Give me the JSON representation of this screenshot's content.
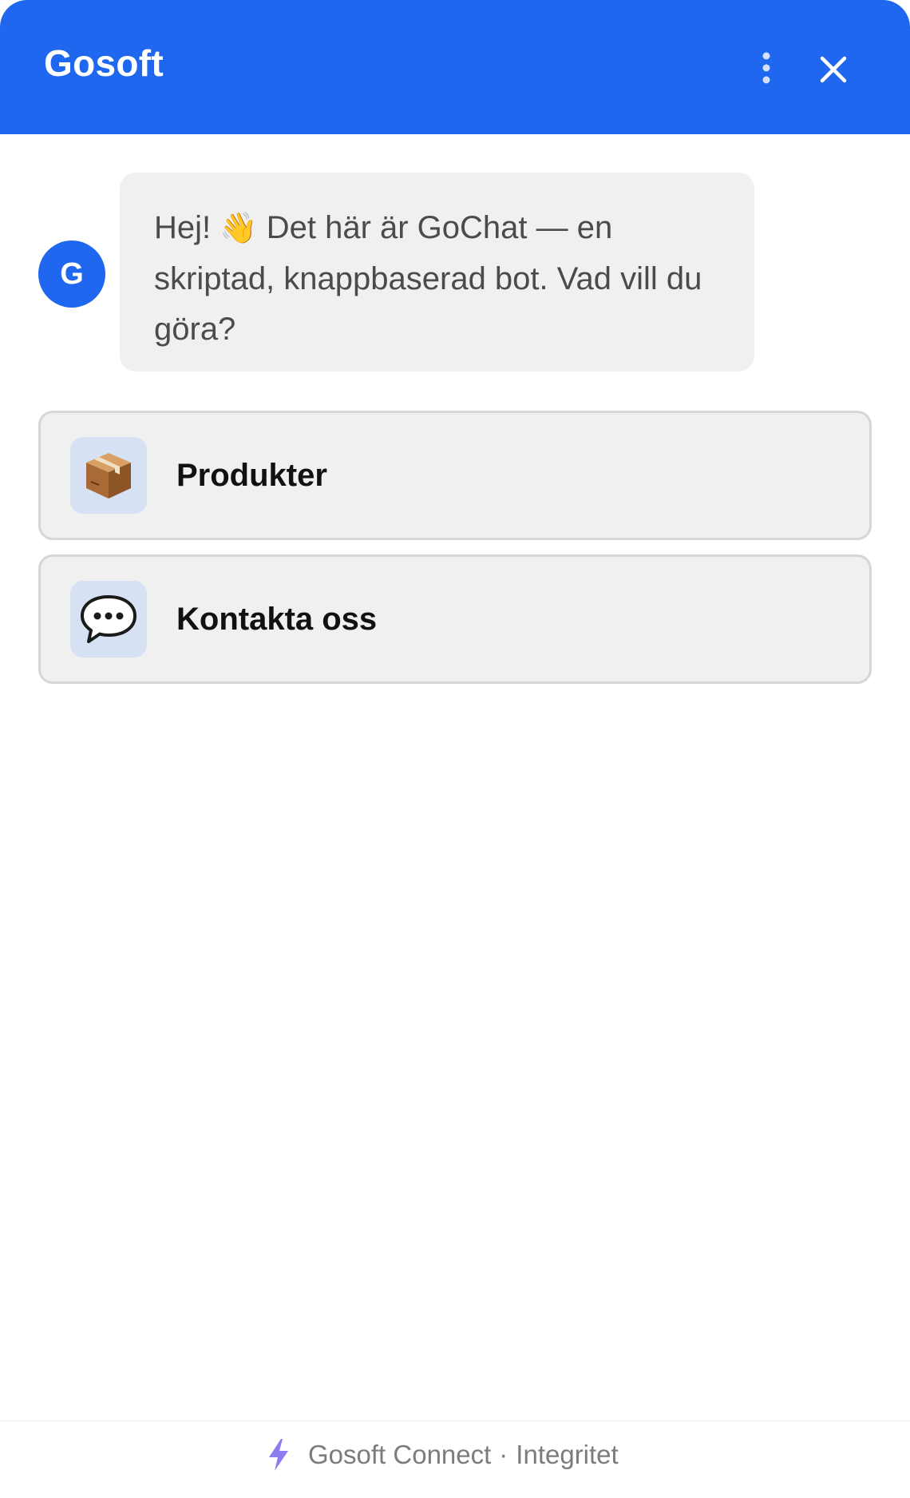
{
  "header": {
    "title": "Gosoft",
    "menu_icon": "more-vertical-icon",
    "close_icon": "close-icon"
  },
  "colors": {
    "brand": "#1e67ee",
    "bubble_bg": "#f0f0f0",
    "option_icon_bg": "#d6e2f4",
    "bolt": "#8b7cf0"
  },
  "message": {
    "avatar_letter": "G",
    "text_before_emoji": "Hej!",
    "emoji": "👋",
    "text_after_emoji": "Det här är GoChat — en skriptad, knappbaserad bot. Vad vill du göra?"
  },
  "options": [
    {
      "label": "Produkter",
      "icon": "package-icon"
    },
    {
      "label": "Kontakta oss",
      "icon": "speech-bubble-icon"
    }
  ],
  "footer": {
    "icon": "lightning-bolt-icon",
    "brand_link": "Gosoft Connect",
    "separator": "·",
    "privacy_link": "Integritet"
  }
}
